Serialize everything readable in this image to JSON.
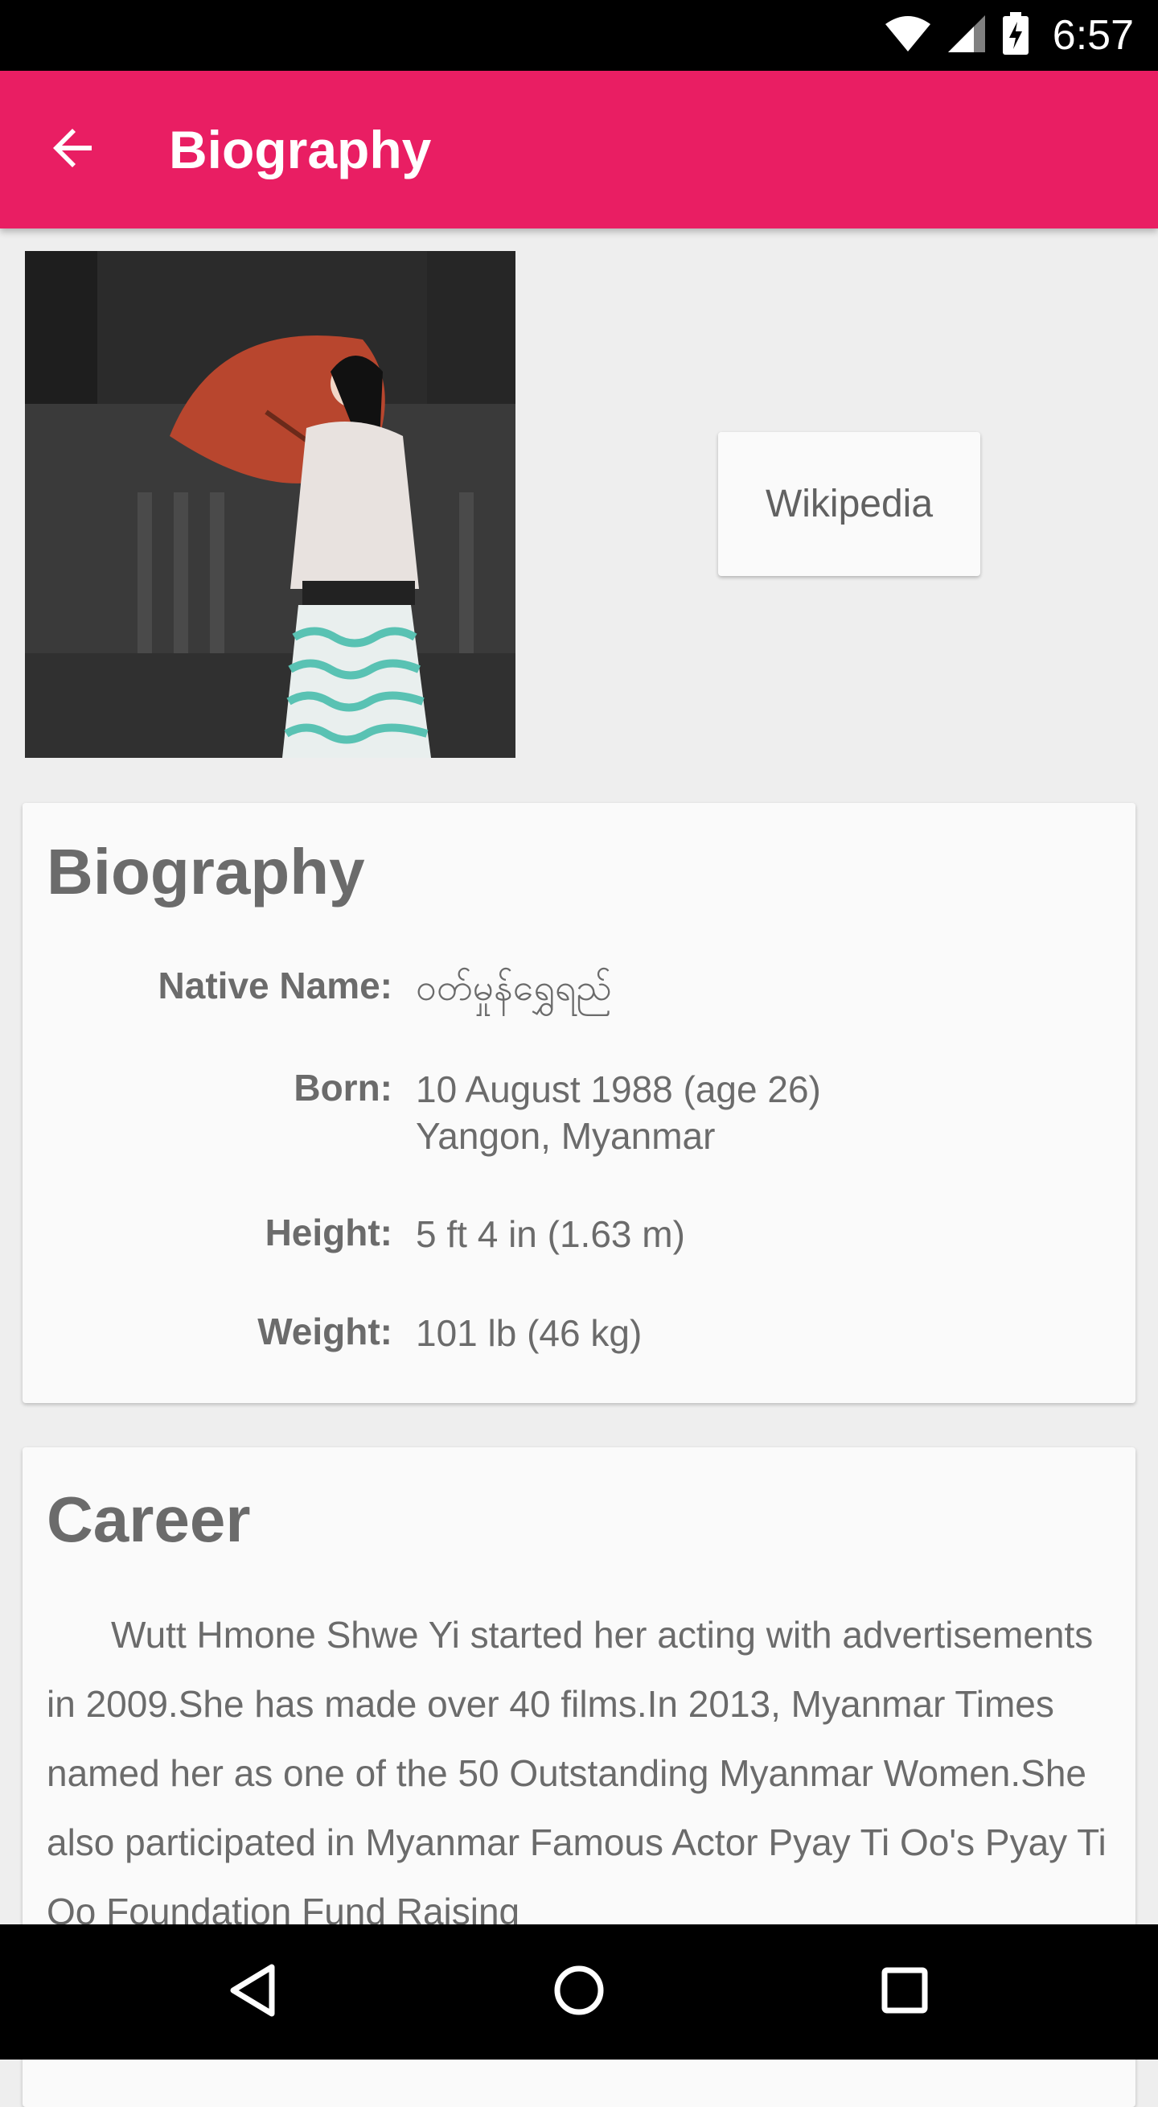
{
  "status_bar": {
    "time": "6:57",
    "icons": [
      "wifi-icon",
      "cell-signal-icon",
      "battery-charging-icon"
    ]
  },
  "app_bar": {
    "title": "Biography",
    "back_icon": "arrow-back-icon",
    "color": "#e91e63"
  },
  "profile": {
    "photo_icon": "profile-photo",
    "wiki_button_label": "Wikipedia"
  },
  "biography": {
    "title": "Biography",
    "rows": [
      {
        "label": "Native Name:",
        "value": "ဝတ်မှုန်ရွှေရည်"
      },
      {
        "label": "Born:",
        "value": "10 August 1988 (age 26)",
        "value2": "Yangon, Myanmar"
      },
      {
        "label": "Height:",
        "value": "5 ft 4 in (1.63 m)"
      },
      {
        "label": "Weight:",
        "value": "101 lb (46 kg)"
      }
    ]
  },
  "career": {
    "title": "Career",
    "text": "Wutt Hmone Shwe Yi started her acting with advertisements in 2009.She has made over 40 films.In 2013, Myanmar Times named her as one of the 50 Outstanding Myanmar Women.She also participated in Myanmar Famous Actor Pyay Ti Oo's Pyay Ti Oo Foundation Fund Raising"
  },
  "nav_bar": {
    "icons": [
      "back-triangle-icon",
      "home-circle-icon",
      "recents-square-icon"
    ]
  }
}
